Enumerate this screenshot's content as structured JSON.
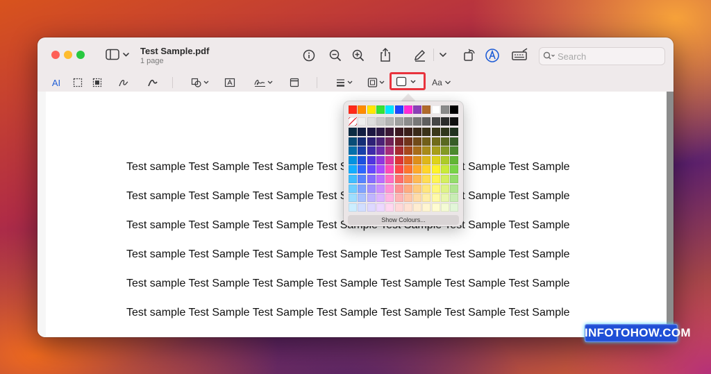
{
  "window": {
    "title": "Test Sample.pdf",
    "subtitle": "1 page"
  },
  "search": {
    "placeholder": "Search"
  },
  "toolbar_icons": {
    "sidebar": "sidebar-icon",
    "info": "info-icon",
    "zoom_out": "zoom-out-icon",
    "zoom_in": "zoom-in-icon",
    "share": "share-icon",
    "markup": "highlighter-icon",
    "rotate": "rotate-icon",
    "markup_pen": "markup-icon",
    "signature": "signature-icon"
  },
  "markup_toolbar": {
    "text_selection": "AI",
    "font_button": "Aa"
  },
  "document": {
    "lines": [
      "Test sample Test Sample Test Sample Test Sample Test Sample Test Sample Test Sample",
      "Test sample Test Sample Test Sample Test Sample Test Sample Test Sample Test Sample",
      "Test sample Test Sample Test Sample Test Sample Test Sample Test Sample Test Sample",
      "Test sample Test Sample Test Sample Test Sample Test Sample Test Sample Test Sample",
      "Test sample Test Sample Test Sample Test Sample Test Sample Test Sample Test Sample",
      "Test sample Test Sample Test Sample Test Sample Test Sample Test Sample Test Sample"
    ]
  },
  "color_popover": {
    "show_colours_label": "Show Colours...",
    "top_row": [
      "#ff2a1a",
      "#ff8c00",
      "#ffe600",
      "#35e335",
      "#00e5ff",
      "#1f44ff",
      "#ff2bd6",
      "#8b3fb8",
      "#b06a2c",
      "#ffffff",
      "#8a8a8a",
      "#000000"
    ],
    "grey_row": [
      "#ffffff",
      "#eeeeee",
      "#dddddd",
      "#c8c8c8",
      "#b4b4b4",
      "#a0a0a0",
      "#8c8c8c",
      "#787878",
      "#5f5f5f",
      "#464646",
      "#2c2c2c",
      "#111111"
    ],
    "hues": [
      "#00a8ff",
      "#1e5cff",
      "#5a3bff",
      "#a53dff",
      "#ff3db2",
      "#ff3b3b",
      "#ff6a1e",
      "#ffa31a",
      "#ffd21a",
      "#fff21a",
      "#c6e92a",
      "#6fd13a"
    ]
  },
  "watermark": {
    "text": "INFOTOHOW.COM"
  },
  "colors": {
    "accent_highlight": "#e8333d",
    "markup_blue": "#1f5dd6"
  }
}
